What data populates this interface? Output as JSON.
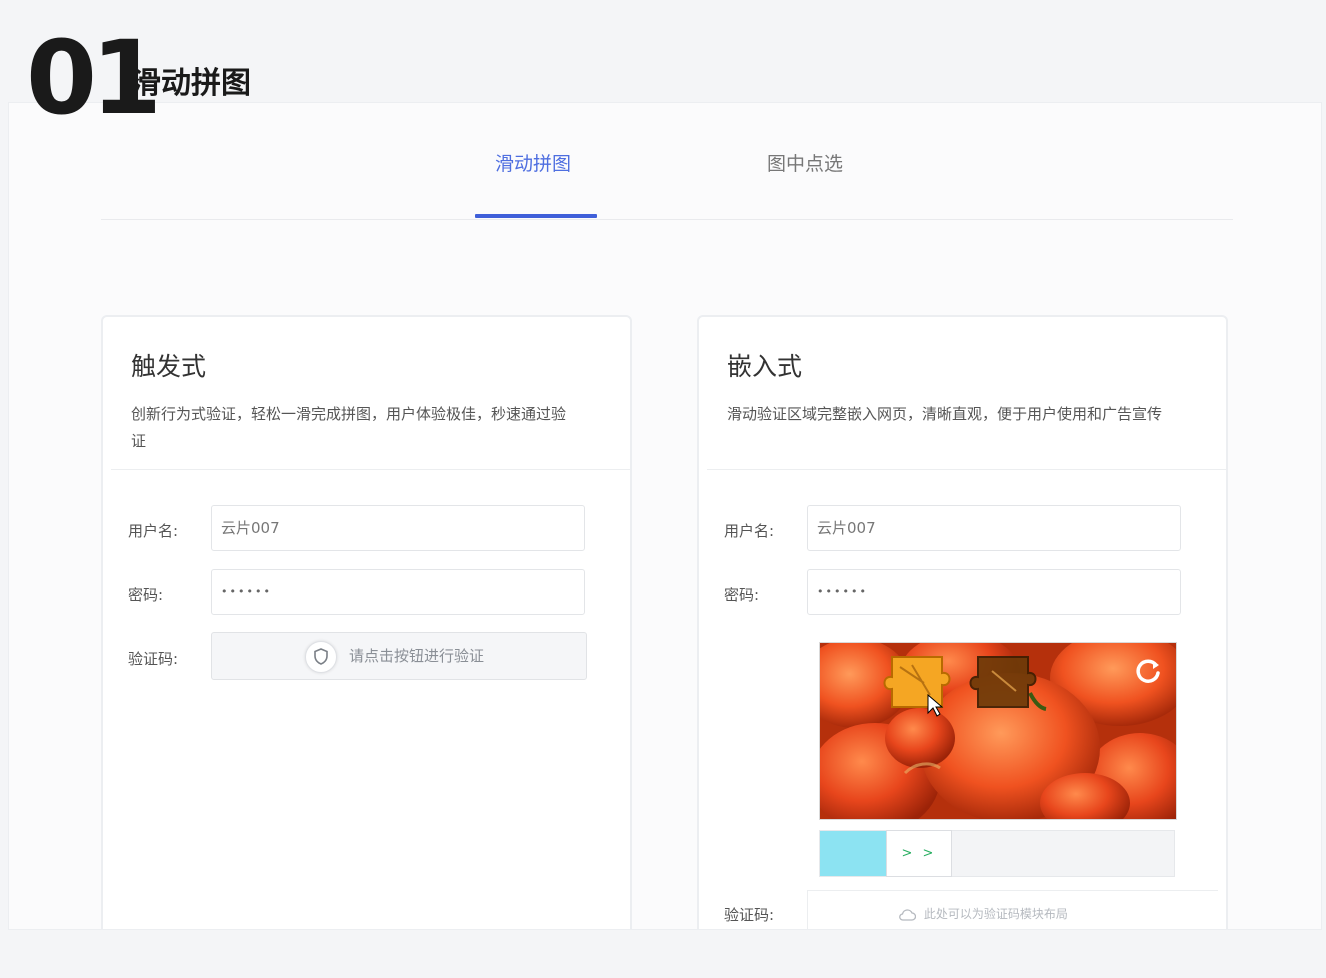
{
  "header": {
    "number": "01",
    "title": "滑动拼图"
  },
  "tabs": [
    {
      "label": "滑动拼图",
      "active": true
    },
    {
      "label": "图中点选",
      "active": false
    }
  ],
  "cards": {
    "trigger": {
      "title": "触发式",
      "description": "创新行为式验证，轻松一滑完成拼图，用户体验极佳，秒速通过验证",
      "username_label": "用户名:",
      "username_value": "云片007",
      "password_label": "密码:",
      "password_value": "••••••",
      "captcha_label": "验证码:",
      "captcha_button": "请点击按钮进行验证"
    },
    "embedded": {
      "title": "嵌入式",
      "description": "滑动验证区域完整嵌入网页，清晰直观，便于用户使用和广告宣传",
      "username_label": "用户名:",
      "username_value": "云片007",
      "password_label": "密码:",
      "password_value": "••••••",
      "slider_arrows": "> >",
      "captcha_label": "验证码:",
      "captcha_hint": "此处可以为验证码模块布局"
    }
  },
  "colors": {
    "accent": "#3f5fd9",
    "slider_fill": "#8ce3f2",
    "arrow": "#27ae60"
  },
  "icons": [
    "shield-icon",
    "refresh-icon",
    "cloud-icon"
  ]
}
